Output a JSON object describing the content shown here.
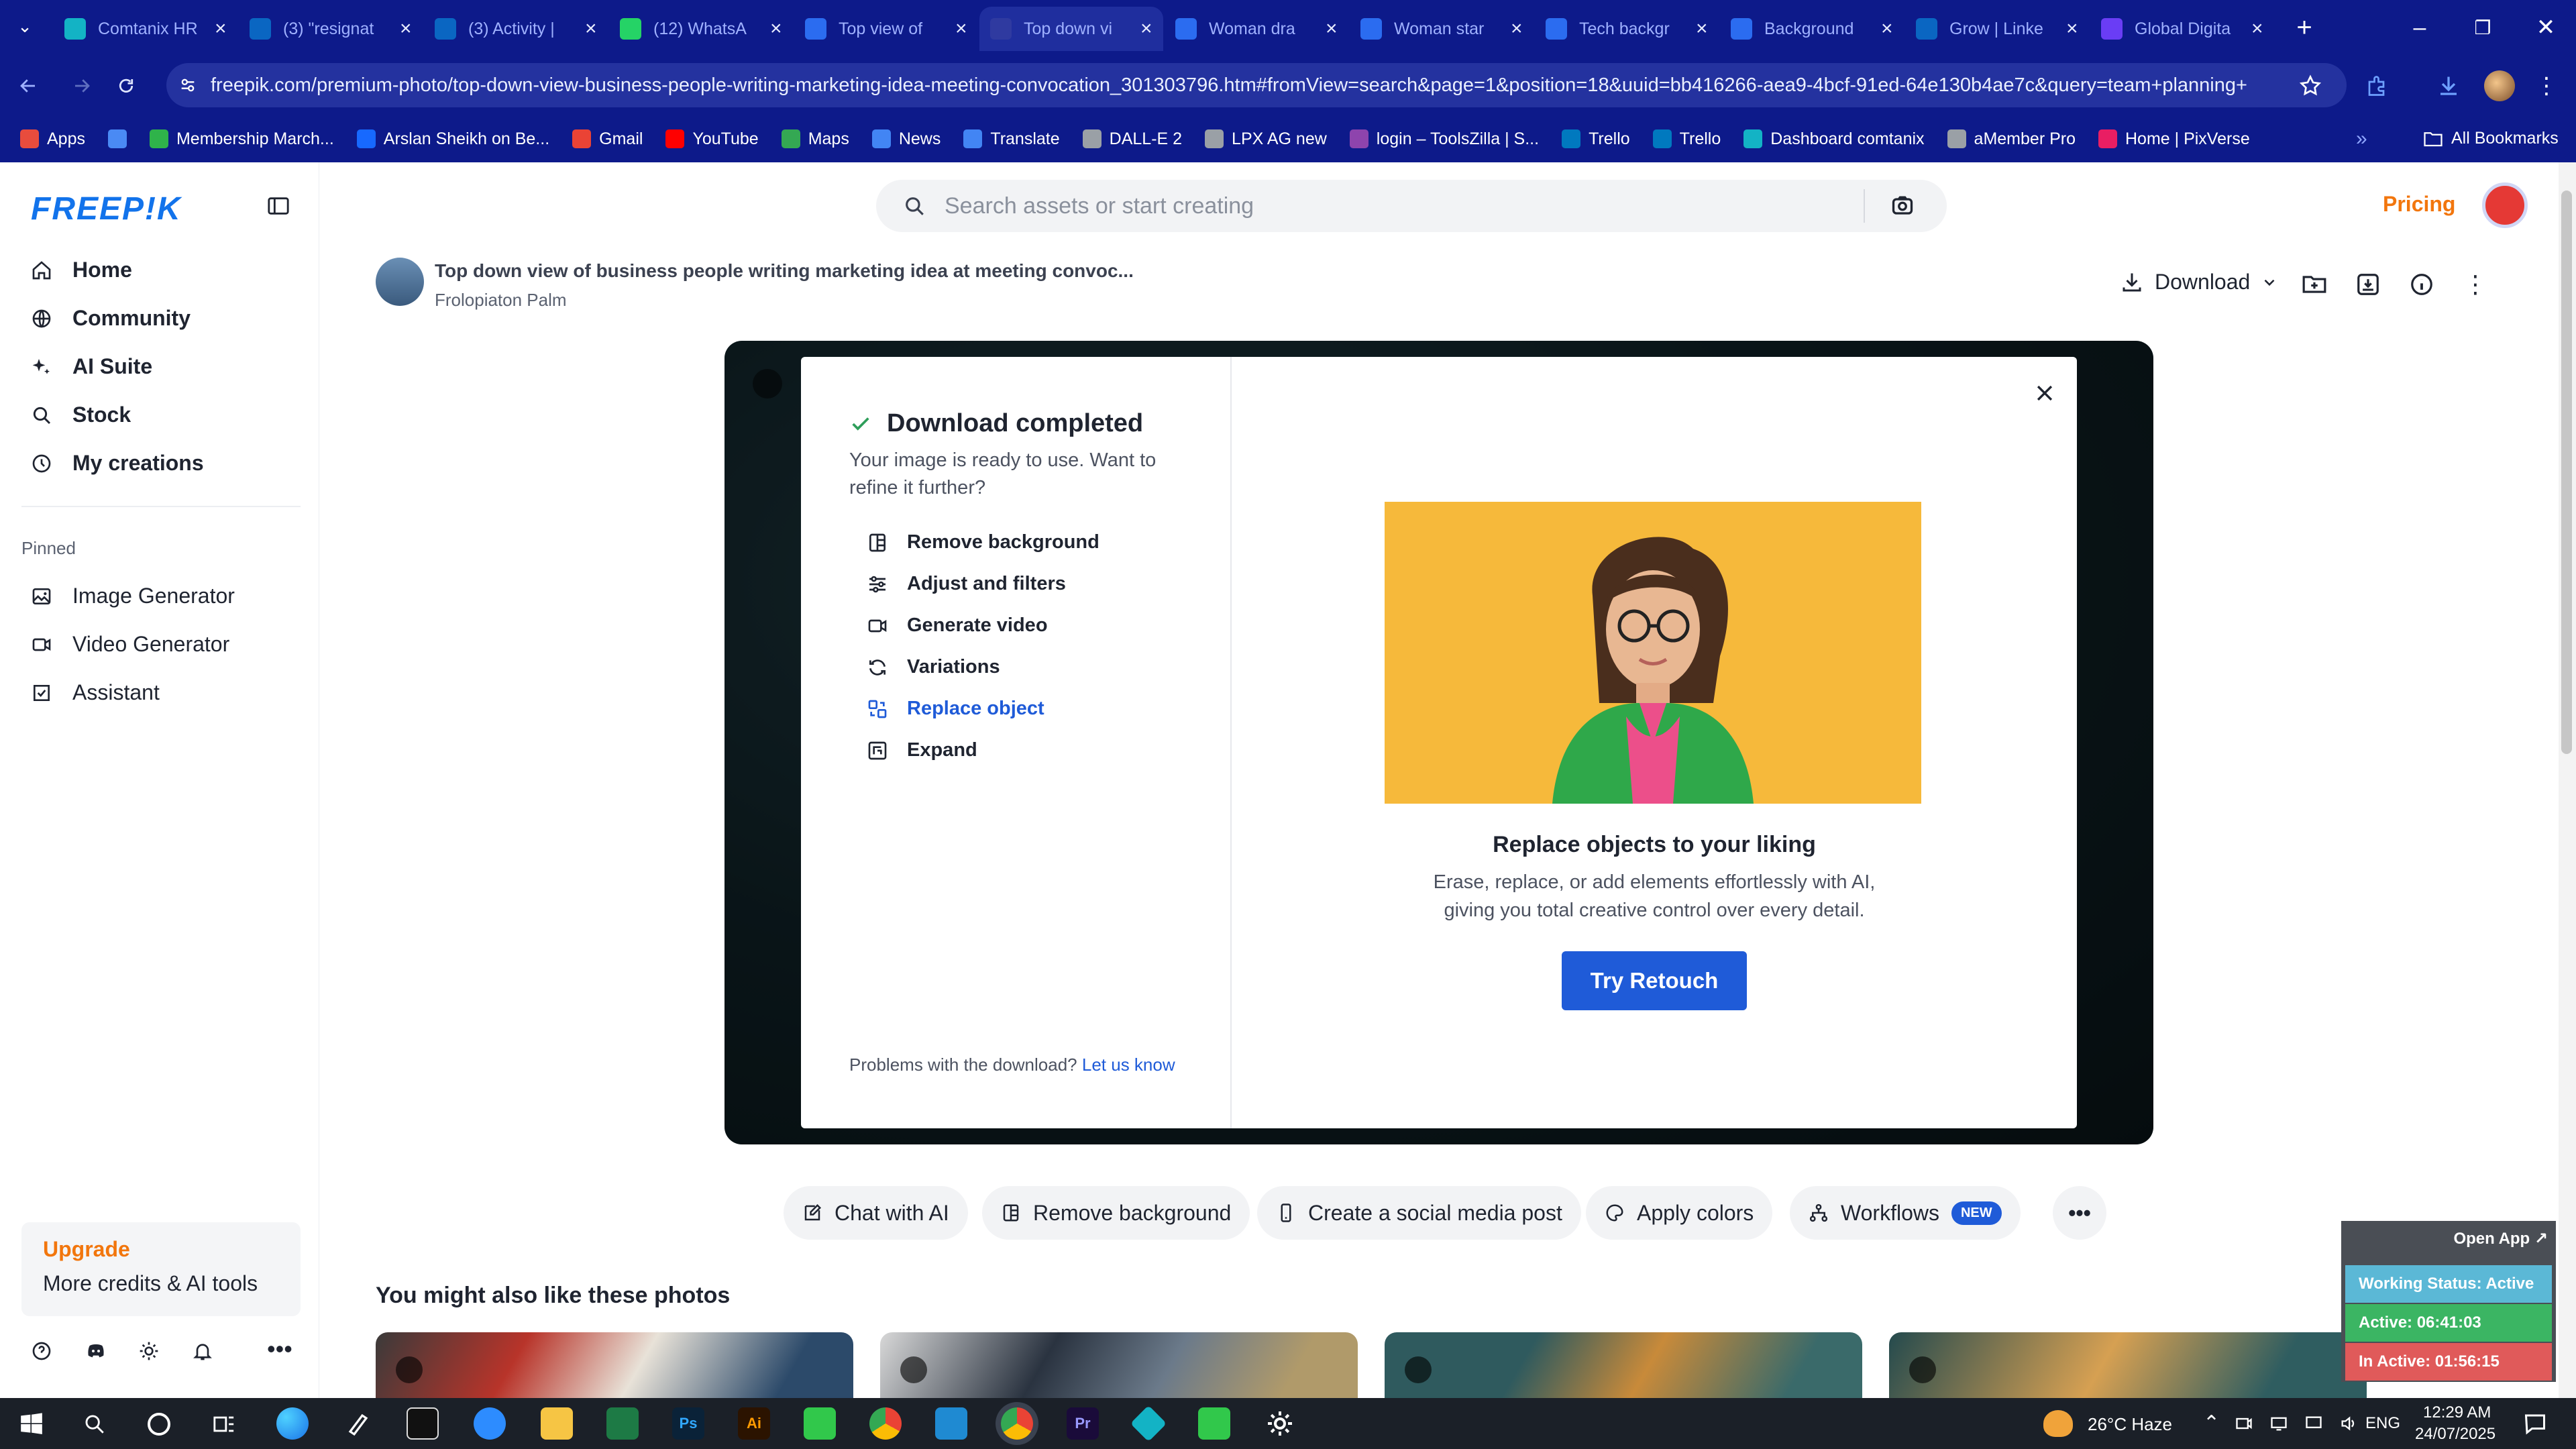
{
  "browser": {
    "tabs": [
      {
        "title": "Comtanix HR",
        "icon": "comtanix-icon",
        "color": "#13b3c5"
      },
      {
        "title": "(3) \"resignat",
        "icon": "linkedin-icon",
        "color": "#0a66c2"
      },
      {
        "title": "(3) Activity |",
        "icon": "linkedin-icon",
        "color": "#0a66c2"
      },
      {
        "title": "(12) WhatsA",
        "icon": "whatsapp-icon",
        "color": "#25d366"
      },
      {
        "title": "Top view of ",
        "icon": "docs-icon",
        "color": "#2b6cf0"
      },
      {
        "title": "Top down vi",
        "icon": "freepik-icon",
        "color": "#2f3aa0",
        "active": true
      },
      {
        "title": "Woman dra",
        "icon": "docs-icon",
        "color": "#2b6cf0"
      },
      {
        "title": "Woman star",
        "icon": "docs-icon",
        "color": "#2b6cf0"
      },
      {
        "title": "Tech backgr",
        "icon": "docs-icon",
        "color": "#2b6cf0"
      },
      {
        "title": "Background",
        "icon": "docs-icon",
        "color": "#2b6cf0"
      },
      {
        "title": "Grow | Linke",
        "icon": "linkedin-icon",
        "color": "#0a66c2"
      },
      {
        "title": "Global Digita",
        "icon": "brand-icon",
        "color": "#6a3df5"
      }
    ],
    "url": "freepik.com/premium-photo/top-down-view-business-people-writing-marketing-idea-meeting-convocation_301303796.htm#fromView=search&page=1&position=18&uuid=bb416266-aea9-4bcf-91ed-64e130b4ae7c&query=team+planning+",
    "bookmarks": [
      {
        "label": "Apps",
        "color": "#e84c3d"
      },
      {
        "label": "",
        "color": "#4a8af4"
      },
      {
        "label": "Membership March...",
        "color": "#2fb34a"
      },
      {
        "label": "Arslan Sheikh on Be...",
        "color": "#1769ff"
      },
      {
        "label": "Gmail",
        "color": "#ea4335"
      },
      {
        "label": "YouTube",
        "color": "#ff0000"
      },
      {
        "label": "Maps",
        "color": "#34a853"
      },
      {
        "label": "News",
        "color": "#4285f4"
      },
      {
        "label": "Translate",
        "color": "#4285f4"
      },
      {
        "label": "DALL-E 2",
        "color": "#9aa0a6"
      },
      {
        "label": "LPX AG new",
        "color": "#9aa0a6"
      },
      {
        "label": "login – ToolsZilla | S...",
        "color": "#8e44ad"
      },
      {
        "label": "Trello",
        "color": "#0079bf"
      },
      {
        "label": "Trello",
        "color": "#0079bf"
      },
      {
        "label": "Dashboard comtanix",
        "color": "#13b3c5"
      },
      {
        "label": "aMember Pro",
        "color": "#9aa0a6"
      },
      {
        "label": "Home | PixVerse",
        "color": "#e91e63"
      }
    ],
    "all_bookmarks": "All Bookmarks"
  },
  "sidebar": {
    "logo": "FREEP!K",
    "nav": [
      {
        "label": "Home",
        "icon": "home-icon"
      },
      {
        "label": "Community",
        "icon": "globe-icon"
      },
      {
        "label": "AI Suite",
        "icon": "sparkle-icon"
      },
      {
        "label": "Stock",
        "icon": "search-icon"
      },
      {
        "label": "My creations",
        "icon": "clock-icon"
      }
    ],
    "pinned_label": "Pinned",
    "pinned": [
      {
        "label": "Image Generator",
        "icon": "image-icon"
      },
      {
        "label": "Video Generator",
        "icon": "video-icon"
      },
      {
        "label": "Assistant",
        "icon": "assistant-icon"
      }
    ],
    "upgrade_title": "Upgrade",
    "upgrade_sub": "More credits & AI tools"
  },
  "header": {
    "search_placeholder": "Search assets or start creating",
    "pricing": "Pricing"
  },
  "asset": {
    "title": "Top down view of business people writing marketing idea at meeting convoc...",
    "author": "Frolopiaton Palm",
    "download_label": "Download"
  },
  "modal": {
    "title": "Download completed",
    "desc": "Your image is ready to use. Want to refine it further?",
    "options": [
      {
        "label": "Remove background",
        "icon": "remove-bg-icon"
      },
      {
        "label": "Adjust and filters",
        "icon": "sliders-icon"
      },
      {
        "label": "Generate video",
        "icon": "video-icon"
      },
      {
        "label": "Variations",
        "icon": "refresh-icon"
      },
      {
        "label": "Replace object",
        "icon": "replace-icon",
        "active": true
      },
      {
        "label": "Expand",
        "icon": "expand-icon"
      }
    ],
    "problem_text": "Problems with the download?",
    "problem_link": "Let us know",
    "promo_title": "Replace objects to your liking",
    "promo_desc": "Erase, replace, or add elements effortlessly with AI, giving you total creative control over every detail.",
    "cta": "Try Retouch"
  },
  "chips": [
    {
      "label": "Chat with AI",
      "icon": "chat-edit-icon"
    },
    {
      "label": "Remove background",
      "icon": "remove-bg-icon"
    },
    {
      "label": "Create a social media post",
      "icon": "phone-icon"
    },
    {
      "label": "Apply colors",
      "icon": "palette-icon"
    },
    {
      "label": "Workflows",
      "icon": "workflow-icon",
      "badge": "NEW"
    }
  ],
  "also_like": "You might also like these photos",
  "work_status": {
    "open": "Open App ↗",
    "status": "Working Status: Active",
    "active": "Active: 06:41:03",
    "inactive": "In Active: 01:56:15"
  },
  "taskbar": {
    "weather": "26°C  Haze",
    "lang": "ENG",
    "time": "12:29 AM",
    "date": "24/07/2025"
  }
}
